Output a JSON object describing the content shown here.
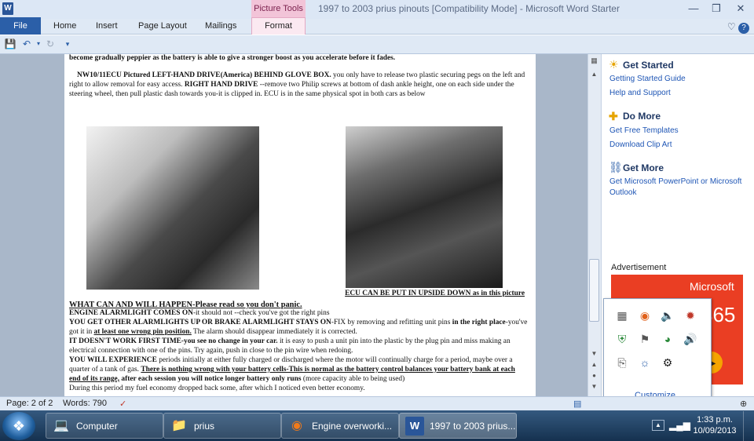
{
  "window": {
    "title": "1997 to 2003 prius pinouts [Compatibility Mode]  -  Microsoft Word Starter",
    "app_icon_letter": "W",
    "contextual_tab_group": "Picture Tools"
  },
  "ribbon": {
    "tabs": [
      "File",
      "Home",
      "Insert",
      "Page Layout",
      "Mailings",
      "Format"
    ]
  },
  "document": {
    "top_line": "become gradually peppier as the battery is able to give a stronger boost as you accelerate before it fades.",
    "p1_lead": "NW10/11ECU Pictured LEFT-HAND DRIVE(America) BEHIND GLOVE BOX.",
    "p1_rest": " you only have to release two plastic securing pegs on the left and right to allow removal for easy access.",
    "p1_rhd": " RIGHT HAND DRIVE",
    "p1_tail": " --remove two Philip screws at bottom of dash ankle height, one on each side under the steering wheel, then pull plastic dash towards you-it is clipped in. ECU is in the same physical spot in both cars as below",
    "caption": "ECU CAN BE PUT IN UPSIDE DOWN as in this picture",
    "heading": "WHAT CAN AND WILL HAPPEN-Please read so you don't panic.",
    "l1_b": "ENGINE ALARMLIGHT COMES ON",
    "l1_r": "-it should not --check you've got the right pins",
    "l2_b": "YOU GET OTHER ALARMLIGHTS UP OR BRAKE ALARMLIGHT STAYS ON",
    "l2_r": "-FIX by removing and refitting unit pins ",
    "l2_b2": "in the right place",
    "l2_r2": "-you've got it in ",
    "l2_b3": "at least one wrong pin position.",
    "l2_r3": " The alarm should disappear immediately it is corrected.",
    "l3_b": "IT DOESN'T WORK FIRST TIME-you see no change in your car.",
    "l3_r": " it is easy to push a unit pin into the plastic by the plug pin and miss making an electrical connection with one of the pins. Try again, push in close to the pin wire when redoing.",
    "l4_b": "YOU WILL EXPERIENCE",
    "l4_r": " periods initially at either fully charged or discharged where the motor will continually charge for a period, maybe over a quarter of a tank of gas. ",
    "l4_u": "There is nothing wrong with your battery cells-This is normal as the battery control balances your battery bank at each end of its range,",
    "l4_b2": " after each session you will notice longer battery only runs",
    "l4_r2": " (more capacity able to being used)",
    "l5": "During this period my fuel economy dropped back some, after which I noticed even better economy."
  },
  "side_pane": {
    "sections": [
      {
        "title": "Get Started",
        "icon": "lightbulb-icon",
        "links": [
          "Getting Started Guide",
          "Help and Support"
        ]
      },
      {
        "title": "Do More",
        "icon": "plus-icon",
        "links": [
          "Get Free Templates",
          "Download Clip Art"
        ]
      },
      {
        "title": "Get More",
        "icon": "cart-icon",
        "links": [
          "Get Microsoft PowerPoint or Microsoft Outlook"
        ]
      }
    ],
    "ad_label": "Advertisement",
    "ad_brand": "Microsoft",
    "ad_number": "365"
  },
  "tray_popup": {
    "icons": [
      "network-monitor-icon",
      "update-icon",
      "volume-muted-icon",
      "gear-colorful-icon",
      "shield-check-icon",
      "flag-icon",
      "speedometer-icon",
      "speaker-icon",
      "usb-icon",
      "globe-icon",
      "gamepad-icon"
    ],
    "customize": "Customize..."
  },
  "status": {
    "page": "Page: 2 of 2",
    "words": "Words: 790"
  },
  "taskbar": {
    "items": [
      {
        "label": "Computer",
        "icon": "computer-icon"
      },
      {
        "label": "prius",
        "icon": "folder-icon"
      },
      {
        "label": "Engine overworki...",
        "icon": "firefox-icon"
      },
      {
        "label": "1997 to 2003 prius...",
        "icon": "word-icon"
      }
    ],
    "time": "1:33 p.m.",
    "date": "10/09/2013"
  }
}
